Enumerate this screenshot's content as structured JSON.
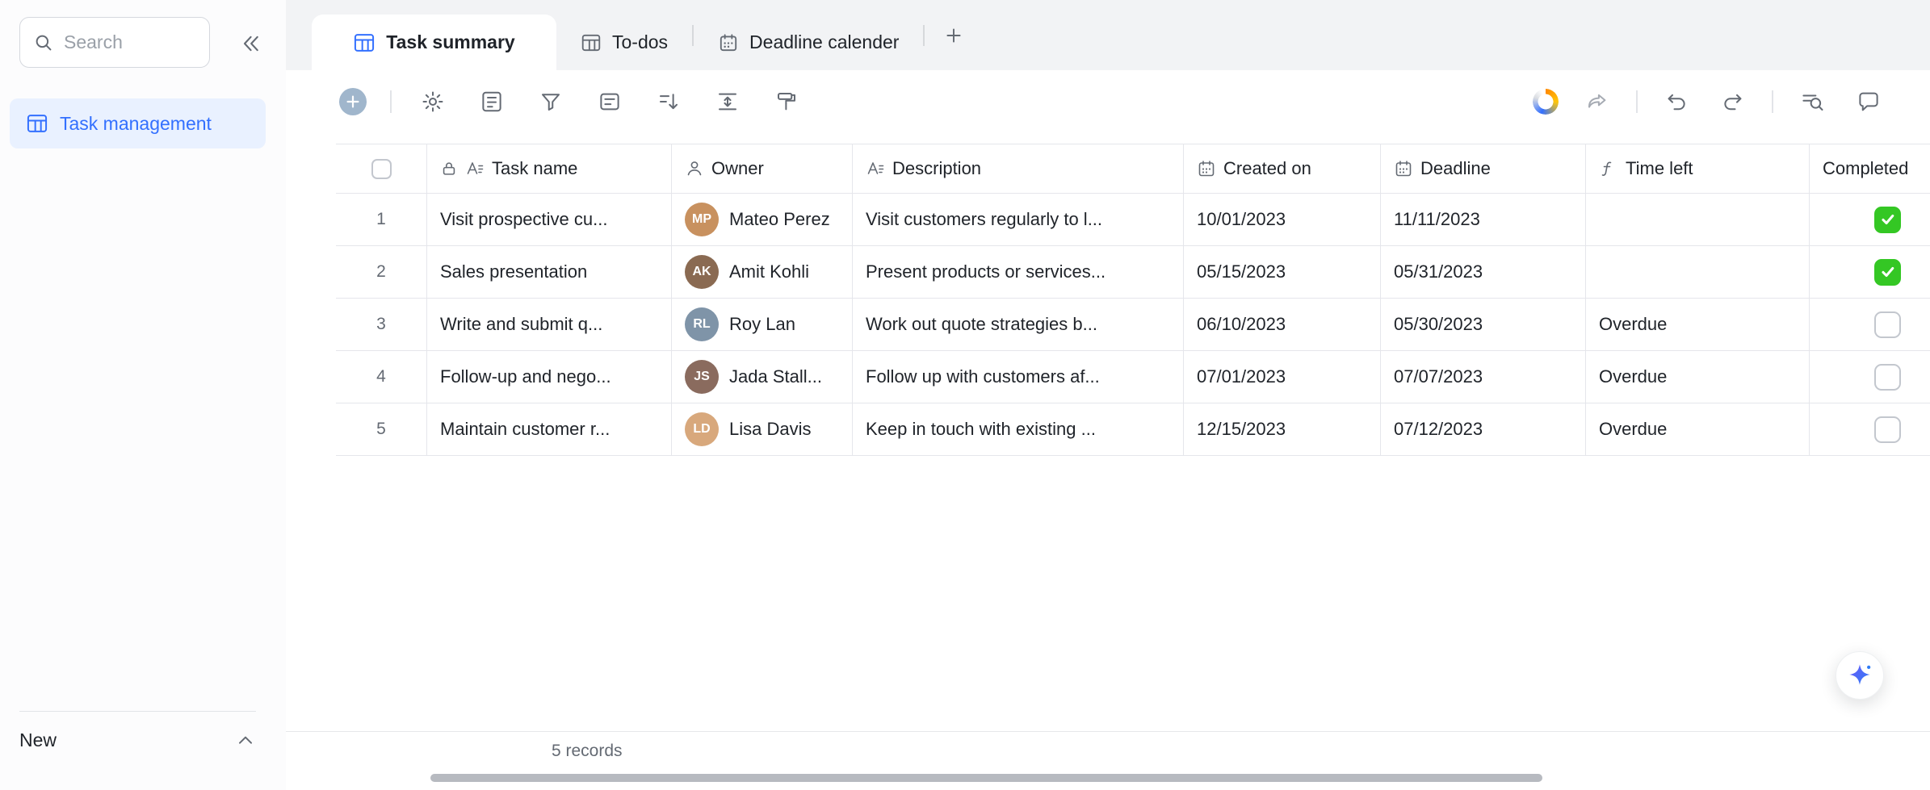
{
  "accent_color": "#3370ff",
  "success_color": "#34c724",
  "sidebar": {
    "search_placeholder": "Search",
    "items": [
      {
        "label": "Task management"
      }
    ],
    "new_label": "New"
  },
  "tabs": {
    "items": [
      {
        "label": "Task summary",
        "active": true
      },
      {
        "label": "To-dos",
        "active": false
      },
      {
        "label": "Deadline calender",
        "active": false
      }
    ]
  },
  "toolbar": {
    "icons": [
      "add-record-icon",
      "settings-gear-icon",
      "form-icon",
      "filter-icon",
      "group-icon",
      "sort-icon",
      "row-height-icon",
      "paint-format-icon",
      "sync-spinner",
      "share-icon",
      "undo-icon",
      "redo-icon",
      "search-records-icon",
      "comment-icon"
    ]
  },
  "table": {
    "columns": [
      {
        "label": "Task name",
        "icon": "text-field-icon",
        "locked": true
      },
      {
        "label": "Owner",
        "icon": "person-icon"
      },
      {
        "label": "Description",
        "icon": "text-field-icon"
      },
      {
        "label": "Created on",
        "icon": "calendar-icon"
      },
      {
        "label": "Deadline",
        "icon": "calendar-icon"
      },
      {
        "label": "Time left",
        "icon": "formula-icon"
      },
      {
        "label": "Completed",
        "icon": "checkbox-icon"
      }
    ],
    "rows": [
      {
        "num": "1",
        "task": "Visit prospective cu...",
        "owner": "Mateo Perez",
        "owner_initials": "MP",
        "avatar_color": "#c8915f",
        "description": "Visit customers regularly to l...",
        "created_on": "10/01/2023",
        "deadline": "11/11/2023",
        "time_left": "",
        "completed": true
      },
      {
        "num": "2",
        "task": "Sales presentation",
        "owner": "Amit Kohli",
        "owner_initials": "AK",
        "avatar_color": "#8a6a52",
        "description": "Present products or services...",
        "created_on": "05/15/2023",
        "deadline": "05/31/2023",
        "time_left": "",
        "completed": true
      },
      {
        "num": "3",
        "task": "Write and submit q...",
        "owner": "Roy Lan",
        "owner_initials": "RL",
        "avatar_color": "#7f94a8",
        "description": "Work out quote strategies b...",
        "created_on": "06/10/2023",
        "deadline": "05/30/2023",
        "time_left": "Overdue",
        "completed": false
      },
      {
        "num": "4",
        "task": "Follow-up and nego...",
        "owner": "Jada Stall...",
        "owner_initials": "JS",
        "avatar_color": "#8a6b5e",
        "description": "Follow up with customers af...",
        "created_on": "07/01/2023",
        "deadline": "07/07/2023",
        "time_left": "Overdue",
        "completed": false
      },
      {
        "num": "5",
        "task": "Maintain customer r...",
        "owner": "Lisa Davis",
        "owner_initials": "LD",
        "avatar_color": "#d8a87c",
        "description": "Keep in touch with existing ...",
        "created_on": "12/15/2023",
        "deadline": "07/12/2023",
        "time_left": "Overdue",
        "completed": false
      }
    ]
  },
  "footer": {
    "records_label": "5 records"
  }
}
